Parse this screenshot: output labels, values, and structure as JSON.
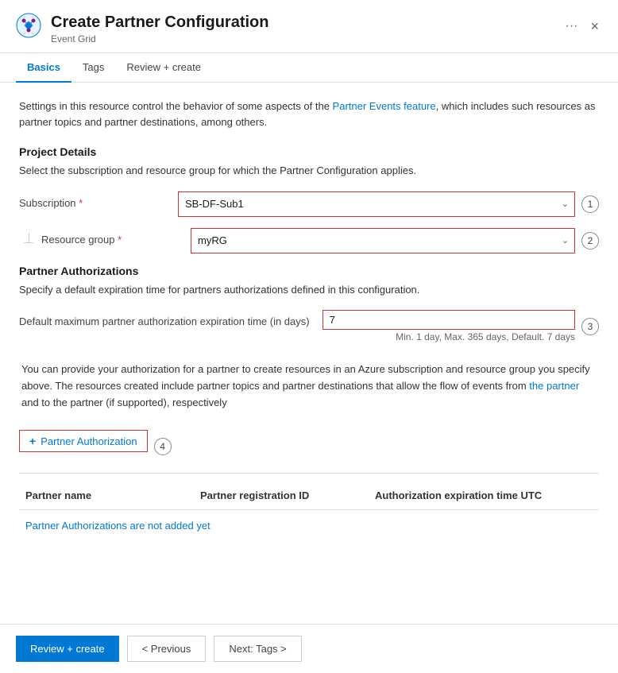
{
  "dialog": {
    "title": "Create Partner Configuration",
    "subtitle": "Event Grid",
    "close_label": "×",
    "dots_label": "···"
  },
  "tabs": [
    {
      "id": "basics",
      "label": "Basics",
      "active": true
    },
    {
      "id": "tags",
      "label": "Tags",
      "active": false
    },
    {
      "id": "review",
      "label": "Review + create",
      "active": false
    }
  ],
  "basics": {
    "description": "Settings in this resource control the behavior of some aspects of the Partner Events feature, which includes such resources as partner topics and partner destinations, among others.",
    "project_details": {
      "title": "Project Details",
      "desc": "Select the subscription and resource group for which the Partner Configuration applies.",
      "subscription_label": "Subscription",
      "subscription_required": "*",
      "subscription_value": "SB-DF-Sub1",
      "subscription_badge": "1",
      "resource_group_label": "Resource group",
      "resource_group_required": "*",
      "resource_group_value": "myRG",
      "resource_group_badge": "2"
    },
    "partner_authorizations": {
      "title": "Partner Authorizations",
      "desc": "Specify a default expiration time for partners authorizations defined in this configuration.",
      "default_max_label": "Default maximum partner authorization expiration time (in days)",
      "default_max_value": "7",
      "default_max_hint": "Min. 1 day, Max. 365 days, Default. 7 days",
      "default_max_badge": "3",
      "info_text": "You can provide your authorization for a partner to create resources in an Azure subscription and resource group you specify above. The resources created include partner topics and partner destinations that allow the flow of events from the partner and to the partner (if supported), respectively",
      "add_button_label": "Partner Authorization",
      "add_badge": "4",
      "table": {
        "columns": [
          "Partner name",
          "Partner registration ID",
          "Authorization expiration time UTC"
        ],
        "empty_message": "Partner Authorizations are not added yet"
      }
    }
  },
  "footer": {
    "review_create_label": "Review + create",
    "previous_label": "< Previous",
    "next_label": "Next: Tags >"
  }
}
